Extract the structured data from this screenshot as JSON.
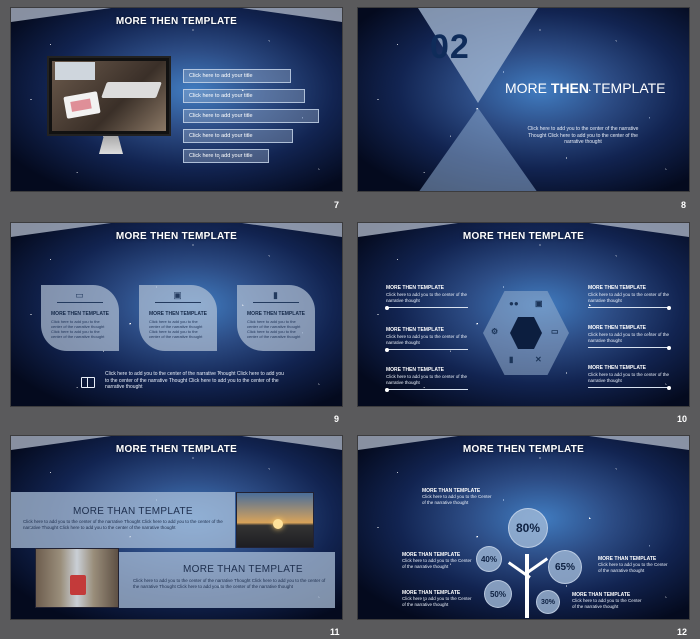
{
  "slides": {
    "s7": {
      "title": "MORE THEN TEMPLATE",
      "number": "7",
      "bars": [
        "Click here to add your title",
        "Click here to add your title",
        "Click here to add your title",
        "Click here to add your title",
        "Click here to add your title"
      ]
    },
    "s8": {
      "number": "8",
      "big_number": "02",
      "heading_pre": "MORE ",
      "heading_bold": "THEN",
      "heading_post": " TEMPLATE",
      "body": "Click here to add  you to the  center of the  narrative Thought  Click here to add   you to  the  center of the narrative thought"
    },
    "s9": {
      "title": "MORE THEN TEMPLATE",
      "number": "9",
      "cards": [
        {
          "icon": "▭",
          "title": "MORE THEN TEMPLATE",
          "desc": "Click here to add  you to the  center  of the narrative thought  Click here to add  you to the  center of the narrative thought"
        },
        {
          "icon": "▣",
          "title": "MORE THEN TEMPLATE",
          "desc": "Click here to add  you to the  center  of the narrative thought  Click here to add  you to the  center of the narrative thought"
        },
        {
          "icon": "▮",
          "title": "MORE THEN TEMPLATE",
          "desc": "Click here to add  you to the  center  of the narrative thought  Click here to add  you to the  center of the narrative thought"
        }
      ],
      "footer": "Click here to add  you to the  center  of the  narrative Thought  Click here to add  you to the  center of the  narrative Thought  Click here to add  you to the  center of the  narrative thought"
    },
    "s10": {
      "title": "MORE THEN TEMPLATE",
      "number": "10",
      "items_left": [
        {
          "title": "MORE THEN TEMPLATE",
          "desc": "Click here to add  you to the  center of the narrative thought"
        },
        {
          "title": "MORE THEN TEMPLATE",
          "desc": "Click here to add  you to the  center of the narrative thought"
        },
        {
          "title": "MORE THEN TEMPLATE",
          "desc": "Click here to add  you to the  center of the narrative thought"
        }
      ],
      "items_right": [
        {
          "title": "MORE THEN TEMPLATE",
          "desc": "Click here to add  you to the  center of the narrative thought"
        },
        {
          "title": "MORE THEN TEMPLATE",
          "desc": "Click here to add  you to the  center of the narrative thought"
        },
        {
          "title": "MORE THEN TEMPLATE",
          "desc": "Click here to add  you to the  center of the narrative thought"
        }
      ]
    },
    "s11": {
      "title": "MORE THEN TEMPLATE",
      "number": "11",
      "block1_title": "MORE  THAN  TEMPLATE",
      "block1_body": "Click here to add  you to the  center of the  narrative Thought  Click here to add  you to the  center of the narrative Thought  Click here to add  you to the  center of the narrative thought",
      "block2_title": "MORE  THAN  TEMPLATE",
      "block2_body": "Click here to add  you to the  center of the  narrative Thought  Click here to add  you to the  center of the narrative Thought  Click here to add  you to the  center of the narrative thought"
    },
    "s12": {
      "title": "MORE THEN TEMPLATE",
      "number": "12",
      "bubbles": [
        "80%",
        "40%",
        "65%",
        "50%",
        "30%"
      ],
      "labels": [
        {
          "title": "MORE THAN TEMPLATE",
          "desc": "Click here to add  you to the  Center of the narrative thought"
        },
        {
          "title": "MORE THAN TEMPLATE",
          "desc": "Click here to add  you to the  Center of the narrative thought"
        },
        {
          "title": "MORE THAN TEMPLATE",
          "desc": "Click here to add  you to the  Center of the narrative thought"
        },
        {
          "title": "MORE THAN TEMPLATE",
          "desc": "Click here to add  you to the  Center of the narrative thought"
        },
        {
          "title": "MORE THAN TEMPLATE",
          "desc": "Click here to add  you to the  Center of the narrative thought"
        }
      ]
    }
  }
}
